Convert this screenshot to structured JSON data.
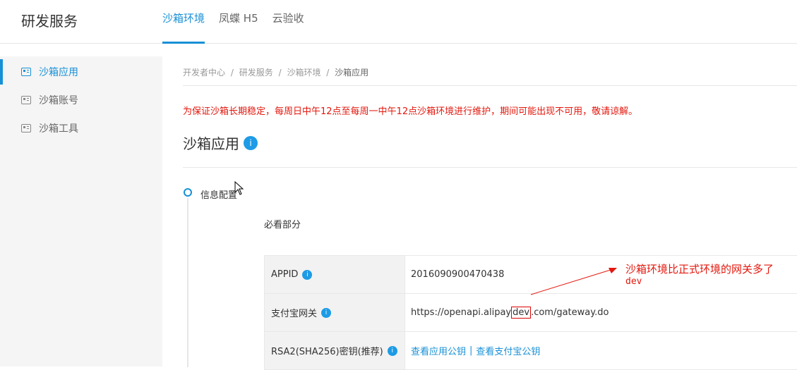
{
  "header": {
    "brand": "研发服务",
    "tabs": [
      {
        "label": "沙箱环境",
        "active": true
      },
      {
        "label": "凤蝶 H5",
        "active": false
      },
      {
        "label": "云验收",
        "active": false
      }
    ]
  },
  "sidebar": {
    "items": [
      {
        "label": "沙箱应用",
        "active": true
      },
      {
        "label": "沙箱账号",
        "active": false
      },
      {
        "label": "沙箱工具",
        "active": false
      }
    ]
  },
  "breadcrumb": {
    "items": [
      "开发者中心",
      "研发服务",
      "沙箱环境"
    ],
    "current": "沙箱应用",
    "separator": "/"
  },
  "notice": "为保证沙箱长期稳定，每周日中午12点至每周一中午12点沙箱环境进行维护，期间可能出现不可用，敬请谅解。",
  "page_title": "沙箱应用",
  "badge_char": "i",
  "timeline": {
    "step_label": "信息配置"
  },
  "section_title": "必看部分",
  "info_rows": {
    "appid": {
      "label": "APPID",
      "value": "2016090900470438"
    },
    "gateway": {
      "label": "支付宝网关",
      "value_prefix": "https://openapi.alipay",
      "value_highlight": "dev",
      "value_suffix": ".com/gateway.do"
    },
    "rsa": {
      "label": "RSA2(SHA256)密钥(推荐)",
      "link_app": "查看应用公钥",
      "link_separator": "|",
      "link_alipay": "查看支付宝公钥"
    }
  },
  "annotation": {
    "line1": "沙箱环境比正式环境的网关多了",
    "line2": "dev"
  },
  "colors": {
    "accent": "#1890d6",
    "notice_red": "#e3170d",
    "sidebar_bg": "#f5f5f5"
  }
}
